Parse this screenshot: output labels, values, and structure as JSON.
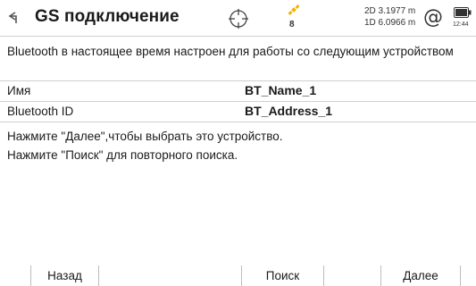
{
  "header": {
    "title": "GS подключение",
    "satellite_count": "8",
    "precision_2d": "2D 3.1977 m",
    "precision_1d": "1D 6.0966 m",
    "at_symbol": "@",
    "battery_time": "12:44"
  },
  "colors": {
    "satellite_accent": "#f0b400",
    "battery": "#333333",
    "divider": "#cfcfcf"
  },
  "description": "Bluetooth в настоящее время настроен для работы со следующим устройством",
  "fields": [
    {
      "label": "Имя",
      "value": "BT_Name_1"
    },
    {
      "label": "Bluetooth ID",
      "value": "BT_Address_1"
    }
  ],
  "instructions": [
    "Нажмите \"Далее\",чтобы выбрать это устройство.",
    "Нажмите \"Поиск\" для повторного поиска."
  ],
  "softkeys": {
    "back": "Назад",
    "search": "Поиск",
    "next": "Далее"
  }
}
